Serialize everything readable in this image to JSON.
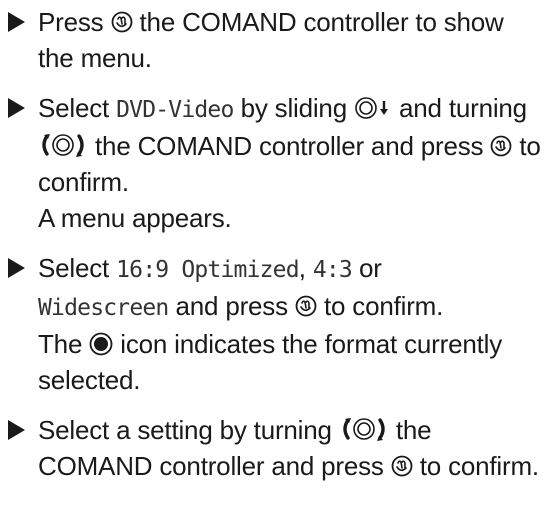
{
  "steps": [
    {
      "pre": "Press",
      "post": "the COMAND controller to show the menu."
    },
    {
      "pre": "Select",
      "code": "DVD-Video",
      "mid1": "by sliding",
      "mid2": "and turning",
      "mid3": "the COMAND controller and press",
      "post": "to confirm.",
      "result": "A menu appears."
    },
    {
      "pre": "Select",
      "code1": "16:9 Optimized",
      "sep1": ",",
      "code2": "4:3",
      "sep2": "or",
      "code3": "Widescreen",
      "mid": "and press",
      "post": "to confirm.",
      "result_pre": "The",
      "result_post": "icon indicates the format currently selected."
    },
    {
      "pre": "Select a setting by turning",
      "mid": "the COMAND controller and press",
      "post": "to confirm."
    }
  ],
  "icons": {
    "press": "press-controller-icon",
    "slide_down": "slide-down-controller-icon",
    "turn": "turn-controller-icon",
    "selected": "radio-selected-icon"
  }
}
